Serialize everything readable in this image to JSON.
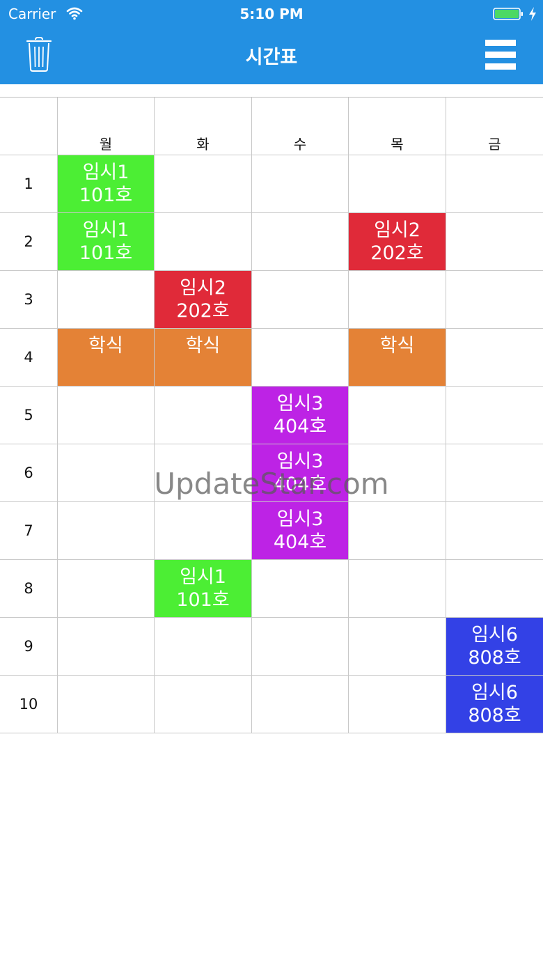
{
  "status_bar": {
    "carrier": "Carrier",
    "time": "5:10 PM"
  },
  "nav": {
    "title": "시간표",
    "trash_icon": "trash-icon",
    "menu_icon": "hamburger-menu-icon",
    "bar_color": "#2390e2"
  },
  "days": [
    "월",
    "화",
    "수",
    "목",
    "금"
  ],
  "periods": [
    "1",
    "2",
    "3",
    "4",
    "5",
    "6",
    "7",
    "8",
    "9",
    "10"
  ],
  "colors": {
    "green": "#4cee34",
    "red": "#e02a39",
    "orange": "#e48236",
    "purple": "#bd23e5",
    "blue": "#3341e6"
  },
  "classes": [
    {
      "period": 1,
      "day": 1,
      "subject": "임시1",
      "room": "101호",
      "color": "#4cee34"
    },
    {
      "period": 2,
      "day": 1,
      "subject": "임시1",
      "room": "101호",
      "color": "#4cee34"
    },
    {
      "period": 2,
      "day": 4,
      "subject": "임시2",
      "room": "202호",
      "color": "#e02a39"
    },
    {
      "period": 3,
      "day": 2,
      "subject": "임시2",
      "room": "202호",
      "color": "#e02a39"
    },
    {
      "period": 4,
      "day": 1,
      "subject": "학식",
      "room": "",
      "color": "#e48236"
    },
    {
      "period": 4,
      "day": 2,
      "subject": "학식",
      "room": "",
      "color": "#e48236"
    },
    {
      "period": 4,
      "day": 4,
      "subject": "학식",
      "room": "",
      "color": "#e48236"
    },
    {
      "period": 5,
      "day": 3,
      "subject": "임시3",
      "room": "404호",
      "color": "#bd23e5"
    },
    {
      "period": 6,
      "day": 3,
      "subject": "임시3",
      "room": "404호",
      "color": "#bd23e5"
    },
    {
      "period": 7,
      "day": 3,
      "subject": "임시3",
      "room": "404호",
      "color": "#bd23e5"
    },
    {
      "period": 8,
      "day": 2,
      "subject": "임시1",
      "room": "101호",
      "color": "#4cee34"
    },
    {
      "period": 9,
      "day": 5,
      "subject": "임시6",
      "room": "808호",
      "color": "#3341e6"
    },
    {
      "period": 10,
      "day": 5,
      "subject": "임시6",
      "room": "808호",
      "color": "#3341e6"
    }
  ],
  "watermark": "UpdateStar.com"
}
